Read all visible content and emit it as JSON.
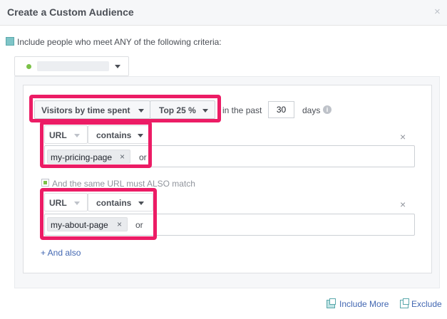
{
  "dialog": {
    "title": "Create a Custom Audience",
    "close_symbol": "×"
  },
  "criteria": {
    "label": "Include people who meet ANY of the following criteria:"
  },
  "rule": {
    "visitors_select": "Visitors by time spent",
    "top_select": "Top 25 %",
    "in_the_past": "in the past",
    "days_value": "30",
    "days_label": "days",
    "info_symbol": "i",
    "conditions": [
      {
        "field": "URL",
        "operator": "contains",
        "token": "my-pricing-page",
        "or_label": "or"
      },
      {
        "field": "URL",
        "operator": "contains",
        "token": "my-about-page",
        "or_label": "or"
      }
    ],
    "same_url_text": "And the same URL must ALSO match",
    "and_also": "+ And also"
  },
  "footer": {
    "include_more": "Include More",
    "exclude": "Exclude"
  },
  "colors": {
    "highlight": "#ec1c65",
    "link": "#4267b2",
    "green_dot": "#7bc148"
  }
}
